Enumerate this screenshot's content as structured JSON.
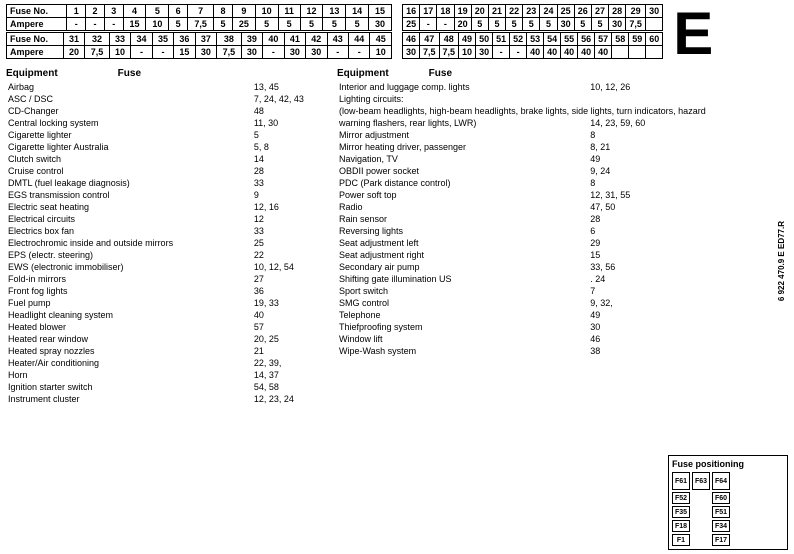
{
  "leftTable": {
    "row1Header": [
      "Fuse No.",
      "1",
      "2",
      "3",
      "4",
      "5",
      "6",
      "7",
      "8",
      "9",
      "10",
      "11",
      "12",
      "13",
      "14",
      "15"
    ],
    "row1Ampere": [
      "Ampere",
      "-",
      "-",
      "-",
      "15",
      "10",
      "5",
      "7,5",
      "5",
      "25",
      "5",
      "5",
      "5",
      "5",
      "5",
      "30"
    ],
    "row2Header": [
      "Fuse No.",
      "31",
      "32",
      "33",
      "34",
      "35",
      "36",
      "37",
      "38",
      "39",
      "40",
      "41",
      "42",
      "43",
      "44",
      "45"
    ],
    "row2Ampere": [
      "Ampere",
      "20",
      "7,5",
      "10",
      "-",
      "-",
      "15",
      "30",
      "7,5",
      "30",
      "-",
      "30",
      "30",
      "-",
      "-",
      "10"
    ]
  },
  "rightTable": {
    "row1Header": [
      "16",
      "17",
      "18",
      "19",
      "20",
      "21",
      "22",
      "23",
      "24",
      "25",
      "26",
      "27",
      "28",
      "29",
      "30"
    ],
    "row1Ampere": [
      "25",
      "-",
      "-",
      "20",
      "5",
      "5",
      "5",
      "5",
      "5",
      "30",
      "5",
      "5",
      "30",
      "7,5"
    ],
    "row2Header": [
      "46",
      "47",
      "48",
      "49",
      "50",
      "51",
      "52",
      "53",
      "54",
      "55",
      "56",
      "57",
      "58",
      "59",
      "60"
    ],
    "row2Ampere": [
      "30",
      "7,5",
      "7,5",
      "10",
      "30",
      "-",
      "-",
      "40",
      "40",
      "40",
      "40",
      "40"
    ]
  },
  "bigE": "E",
  "partNumber": "6 922 470.9 E ED77.R",
  "leftEquipment": {
    "header": "Equipment",
    "fuseHeader": "Fuse",
    "items": [
      [
        "Airbag",
        "13, 45"
      ],
      [
        "ASC / DSC",
        "7, 24, 42, 43"
      ],
      [
        "CD-Changer",
        "48"
      ],
      [
        "Central locking system",
        "11, 30"
      ],
      [
        "Cigarette lighter",
        "5"
      ],
      [
        "Cigarette lighter Australia",
        "5, 8"
      ],
      [
        "Clutch switch",
        "14"
      ],
      [
        "Cruise control",
        "28"
      ],
      [
        "DMTL (fuel leakage diagnosis)",
        "33"
      ],
      [
        "EGS transmission control",
        "9"
      ],
      [
        "Electric seat heating",
        "12, 16"
      ],
      [
        "Electrical circuits",
        "12"
      ],
      [
        "Electrics box fan",
        "33"
      ],
      [
        "Electrochromic inside and outside mirrors",
        "25"
      ],
      [
        "EPS (electr. steering)",
        "22"
      ],
      [
        "EWS (electronic immobiliser)",
        "10, 12, 54"
      ],
      [
        "Fold-in mirrors",
        "27"
      ],
      [
        "Front fog lights",
        "36"
      ],
      [
        "Fuel pump",
        "19, 33"
      ],
      [
        "Headlight cleaning system",
        "40"
      ],
      [
        "Heated blower",
        "57"
      ],
      [
        "Heated rear window",
        "20, 25"
      ],
      [
        "Heated spray nozzles",
        "21"
      ],
      [
        "Heater/Air conditioning",
        "22, 39,"
      ],
      [
        "Horn",
        "14, 37"
      ],
      [
        "Ignition starter switch",
        "54, 58"
      ],
      [
        "Instrument cluster",
        "12, 23, 24"
      ]
    ]
  },
  "rightEquipment": {
    "header": "Equipment",
    "fuseHeader": "Fuse",
    "items": [
      [
        "Interior and luggage comp. lights",
        "10, 12, 26"
      ],
      [
        "Lighting circuits:",
        ""
      ],
      [
        "(low-beam headlights, high-beam headlights, brake lights, side lights, turn indicators, hazard",
        ""
      ],
      [
        "warning flashers, rear lights, LWR)",
        "14, 23, 59, 60"
      ],
      [
        "Mirror adjustment",
        "8"
      ],
      [
        "Mirror heating driver, passenger",
        "8, 21"
      ],
      [
        "Navigation, TV",
        "49"
      ],
      [
        "OBDII power socket",
        "9, 24"
      ],
      [
        "PDC (Park distance control)",
        "8"
      ],
      [
        "Power soft top",
        "12, 31, 55"
      ],
      [
        "Radio",
        "47, 50"
      ],
      [
        "Rain sensor",
        "28"
      ],
      [
        "Reversing lights",
        "6"
      ],
      [
        "Seat adjustment left",
        "29"
      ],
      [
        "Seat adjustment right",
        "15"
      ],
      [
        "Secondary air pump",
        "33, 56"
      ],
      [
        "Shifting gate illumination US",
        ". 24"
      ],
      [
        "Sport switch",
        "7"
      ],
      [
        "SMG control",
        "9, 32,"
      ],
      [
        "Telephone",
        "49"
      ],
      [
        "Thiefproofing system",
        "30"
      ],
      [
        "Window lift",
        "46"
      ],
      [
        "Wipe-Wash system",
        "38"
      ]
    ]
  },
  "fusePositioning": {
    "title": "Fuse positioning",
    "slots": {
      "row1": [
        "F61",
        "F63",
        "F64"
      ],
      "row2": [
        "F52",
        "F60"
      ],
      "row3": [
        "F35",
        "F51"
      ],
      "row4": [
        "F18",
        "F34"
      ],
      "row5": [
        "F1",
        "F17"
      ]
    }
  }
}
